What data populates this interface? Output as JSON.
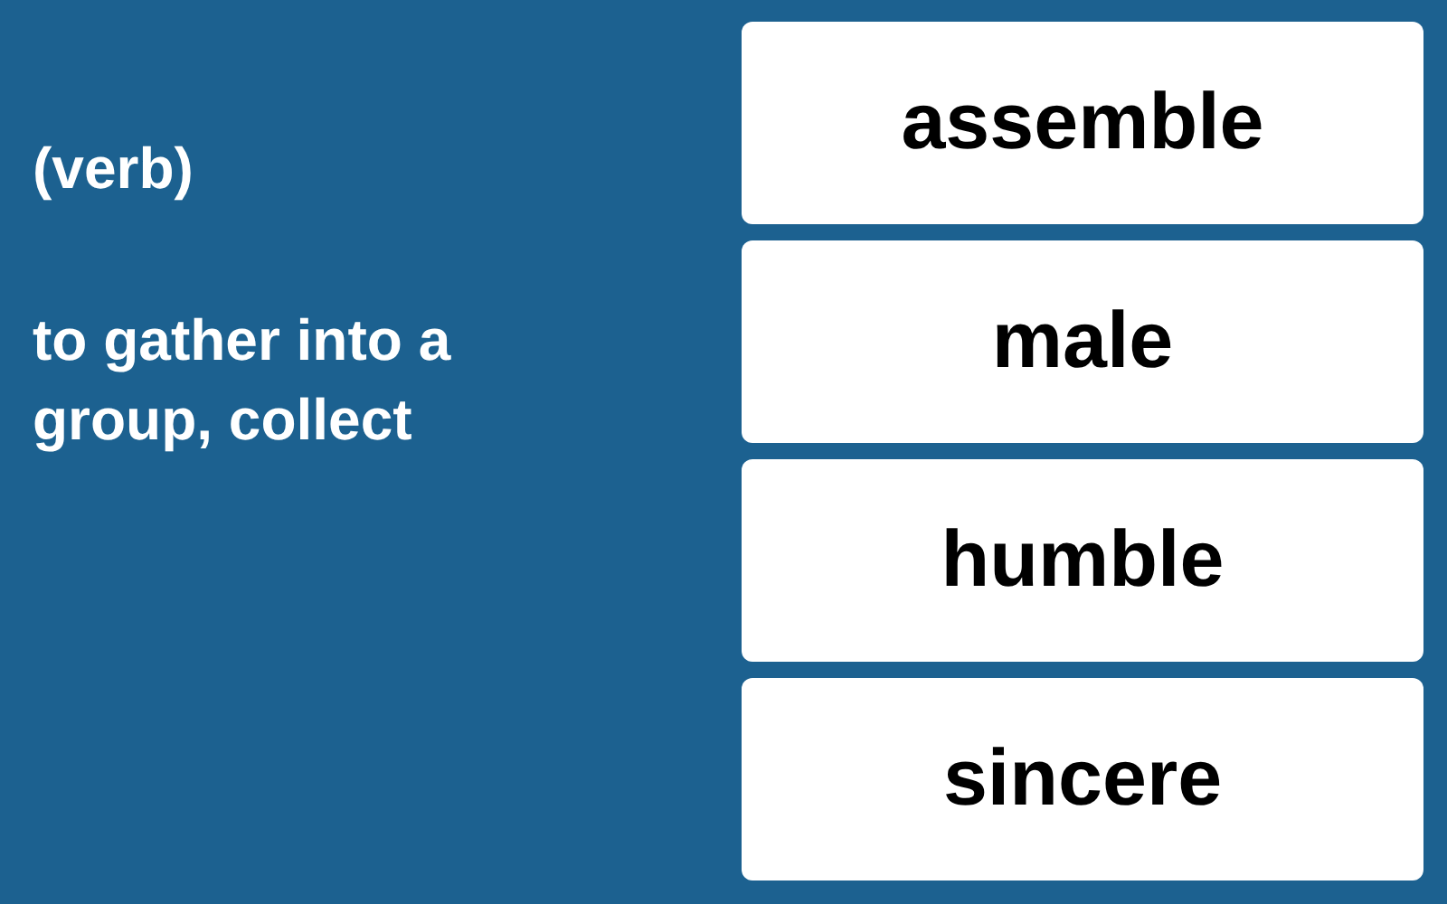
{
  "prompt": {
    "part_of_speech": "(verb)",
    "definition": "to gather into a group, collect"
  },
  "options": [
    {
      "label": "assemble"
    },
    {
      "label": "male"
    },
    {
      "label": "humble"
    },
    {
      "label": "sincere"
    }
  ]
}
